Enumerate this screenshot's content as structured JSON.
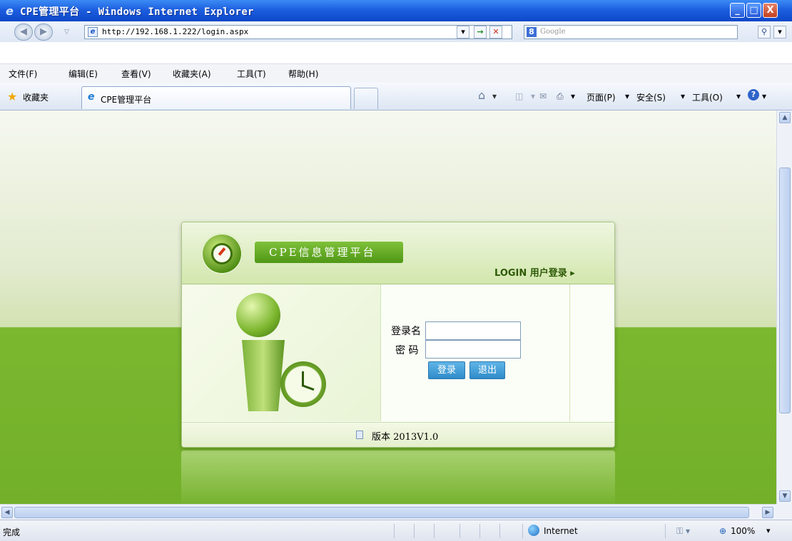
{
  "window": {
    "title": "CPE管理平台 - Windows Internet Explorer",
    "controls": {
      "minimize": "_",
      "maximize": "□",
      "close": "X"
    }
  },
  "address": {
    "url": "http://192.168.1.222/login.aspx",
    "search_placeholder": "Google",
    "search_engine_icon": "8"
  },
  "menu": [
    "文件(F)",
    "编辑(E)",
    "查看(V)",
    "收藏夹(A)",
    "工具(T)",
    "帮助(H)"
  ],
  "favorites": {
    "label": "收藏夹"
  },
  "tab": {
    "title": "CPE管理平台"
  },
  "command_bar": {
    "page": "页面(P)",
    "safety": "安全(S)",
    "tools": "工具(O)"
  },
  "login": {
    "app_title": "CPE信息管理平台",
    "login_label": "LOGIN 用户登录 ▸",
    "username_label": "登录名",
    "password_label": "密 码",
    "username_value": "",
    "password_value": "",
    "login_button": "登录",
    "exit_button": "退出",
    "version": "版本 2013V1.0"
  },
  "status": {
    "text": "完成",
    "zone": "Internet",
    "zoom": "100%"
  },
  "colors": {
    "title_bar": "#1d5fe0",
    "accent_green": "#6fae2a",
    "button_blue": "#2f8bc9"
  }
}
